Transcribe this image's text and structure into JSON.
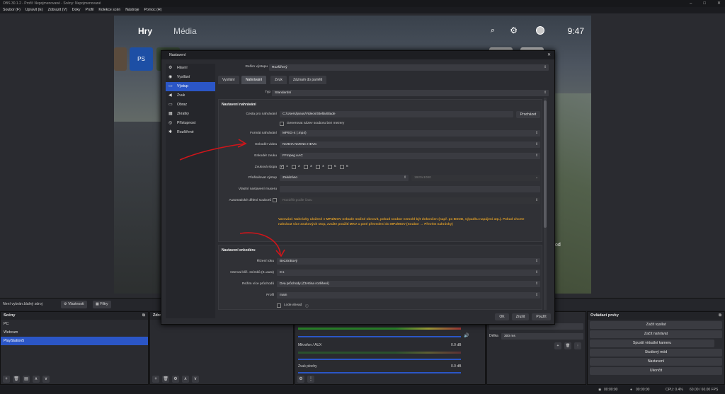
{
  "window": {
    "title": "OBS 30.1.2 - Profil: Nepojmenované - Scény: Nepojmenované",
    "controls": [
      "–",
      "□",
      "✕"
    ]
  },
  "menu": [
    "Soubor (F)",
    "Upravit (E)",
    "Zobrazit (V)",
    "Doky",
    "Profil",
    "Kolekce scén",
    "Nástroje",
    "Pomoc (H)"
  ],
  "preview": {
    "nav": {
      "games": "Hry",
      "media": "Média"
    },
    "time": "9:47",
    "partial_text": "od",
    "ps_tile": "PS"
  },
  "source_bar": {
    "no_source": "Není vybrán žádný zdroj",
    "properties": "Vlastnosti",
    "filters": "Filtry"
  },
  "scenes": {
    "title": "Scény",
    "items": [
      {
        "label": "PC"
      },
      {
        "label": "Webcam"
      },
      {
        "label": "PlayStation5",
        "selected": true
      }
    ]
  },
  "sources": {
    "title": "Zdro"
  },
  "mixer": {
    "channels": [
      {
        "name": "",
        "db": ""
      },
      {
        "name": "Mikrofon / AUX",
        "db": "0.0 dB"
      },
      {
        "name": "Zvuk plochy",
        "db": "0.0 dB"
      }
    ],
    "scale": [
      "-60",
      "-55",
      "-50",
      "-45",
      "-40",
      "-35",
      "-30",
      "-25",
      "-20",
      "-15",
      "-10",
      "-5",
      "0"
    ]
  },
  "transitions": {
    "duration_label": "Délka",
    "duration_value": "300 ms"
  },
  "controls": {
    "title": "Ovládací prvky",
    "buttons": [
      "Začít vysílat",
      "Začít nahrávat",
      "Spustit virtuální kameru",
      "Studiový mód",
      "Nastavení",
      "Ukončit"
    ]
  },
  "status": {
    "rec_time": "00:00:00",
    "stream_time": "00:00:00",
    "cpu": "CPU: 0.4%",
    "fps": "60.00 / 60.00 FPS"
  },
  "settings": {
    "title": "Nastavení",
    "sidebar": [
      {
        "icon": "gear-icon",
        "glyph": "⚙",
        "label": "Hlavní"
      },
      {
        "icon": "broadcast-icon",
        "glyph": "◉",
        "label": "Vysílání"
      },
      {
        "icon": "output-icon",
        "glyph": "▭",
        "label": "Výstup",
        "selected": true
      },
      {
        "icon": "speaker-icon",
        "glyph": "◀",
        "label": "Zvuk"
      },
      {
        "icon": "monitor-icon",
        "glyph": "▭",
        "label": "Obraz"
      },
      {
        "icon": "keyboard-icon",
        "glyph": "▦",
        "label": "Zkratky"
      },
      {
        "icon": "accessibility-icon",
        "glyph": "◎",
        "label": "Přístupnost"
      },
      {
        "icon": "tools-icon",
        "glyph": "✱",
        "label": "Rozšířené"
      }
    ],
    "output_mode": {
      "label": "Režim výstupu",
      "value": "Rozšířený"
    },
    "tabs": [
      "Vysílání",
      "Nahrávání",
      "Zvuk",
      "Záznam do paměti"
    ],
    "active_tab": "Nahrávání",
    "type": {
      "label": "Typ",
      "value": "Standardní"
    },
    "recording": {
      "title": "Nastavení nahrávání",
      "path_label": "Cesta pro nahrávání",
      "path_value": "C:/Users/janus/Videos/StellarBlade",
      "browse": "Procházet",
      "no_space_label": "Generovat název souboru bez mezery",
      "format_label": "Formát nahrávání",
      "format_value": "MPEG-4 (.mp4)",
      "video_encoder_label": "Enkodér videa",
      "video_encoder_value": "NVIDIA NVENC HEVC",
      "audio_encoder_label": "Enkodér zvuku",
      "audio_encoder_value": "FFmpeg AAC",
      "audio_track_label": "Zvuková stopa",
      "tracks": [
        "1",
        "2",
        "3",
        "4",
        "5",
        "6"
      ],
      "rescale_label": "Přeškálovat výstup",
      "rescale_value": "Zakázáno",
      "rescale_res": "1920x1080",
      "custom_muxer_label": "Vlastní nastavení muxeru",
      "auto_split_label": "Automatické dělení souborů",
      "auto_split_value": "Rozdělit podle času",
      "warning": "Varování: Nahrávky uložené v MP4/MOV nebude možné obnovit, pokud soubor nemohl být dokončen (např. po BSOD, výpadku napájení atp.). Pokud chcete nahrávat více zvukových stop, zvažte použití MKV a poté převedení do MP4/MOV (Soubor → Převést nahrávky)"
    },
    "encoder": {
      "title": "Nastavení enkodéru",
      "rate_label": "Řízení toku",
      "rate_value": "Bezztrátový",
      "keyint_label": "Interval klíč. snímků (0=auto)",
      "keyint_value": "0 s",
      "multipass_label": "Režim více průchodů",
      "multipass_value": "Dva průchody (Čtvrtina rozlišení)",
      "profile_label": "Profil",
      "profile_value": "main",
      "lookahead_label": "Look-ahead"
    },
    "buttons": {
      "ok": "OK",
      "cancel": "Zrušit",
      "apply": "Použít"
    }
  }
}
